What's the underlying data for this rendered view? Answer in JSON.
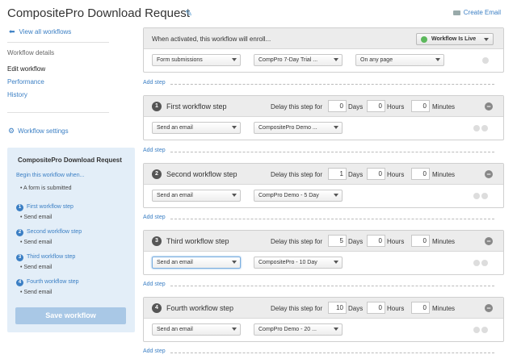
{
  "header": {
    "title": "CompositePro Download Request",
    "create_email": "Create Email"
  },
  "sidebar": {
    "back_link": "View all workflows",
    "section_label": "Workflow details",
    "items": [
      "Edit workflow",
      "Performance",
      "History"
    ],
    "settings": "Workflow settings",
    "summary": {
      "title": "CompositePro Download Request",
      "begin": "Begin this workflow when...",
      "trigger": "• A form is submitted",
      "steps": [
        {
          "num": "1",
          "label": "First workflow step",
          "action": "• Send email"
        },
        {
          "num": "2",
          "label": "Second workflow step",
          "action": "• Send email"
        },
        {
          "num": "3",
          "label": "Third workflow step",
          "action": "• Send email"
        },
        {
          "num": "4",
          "label": "Fourth workflow step",
          "action": "• Send email"
        }
      ],
      "save": "Save workflow"
    }
  },
  "enroll": {
    "text": "When activated, this workflow will enroll...",
    "status": "Workflow Is Live",
    "trigger_type": "Form submissions",
    "form": "CompPro 7-Day Trial ...",
    "page": "On any page"
  },
  "add_step": "Add step",
  "delay_label": "Delay this step for",
  "units": {
    "days": "Days",
    "hours": "Hours",
    "minutes": "Minutes"
  },
  "steps": [
    {
      "num": "1",
      "title": "First workflow step",
      "days": "0",
      "hours": "0",
      "minutes": "0",
      "action": "Send an email",
      "email": "CompositePro Demo ..."
    },
    {
      "num": "2",
      "title": "Second workflow step",
      "days": "1",
      "hours": "0",
      "minutes": "0",
      "action": "Send an email",
      "email": "CompPro Demo - 5 Day"
    },
    {
      "num": "3",
      "title": "Third workflow step",
      "days": "5",
      "hours": "0",
      "minutes": "0",
      "action": "Send an email",
      "email": "CompositePro - 10 Day"
    },
    {
      "num": "4",
      "title": "Fourth workflow step",
      "days": "10",
      "hours": "0",
      "minutes": "0",
      "action": "Send an email",
      "email": "CompPro Demo - 20 ..."
    }
  ],
  "colors": {
    "accent": "#3b7fc4",
    "summary_bg": "#e3eef8",
    "live": "#5cb85c"
  }
}
